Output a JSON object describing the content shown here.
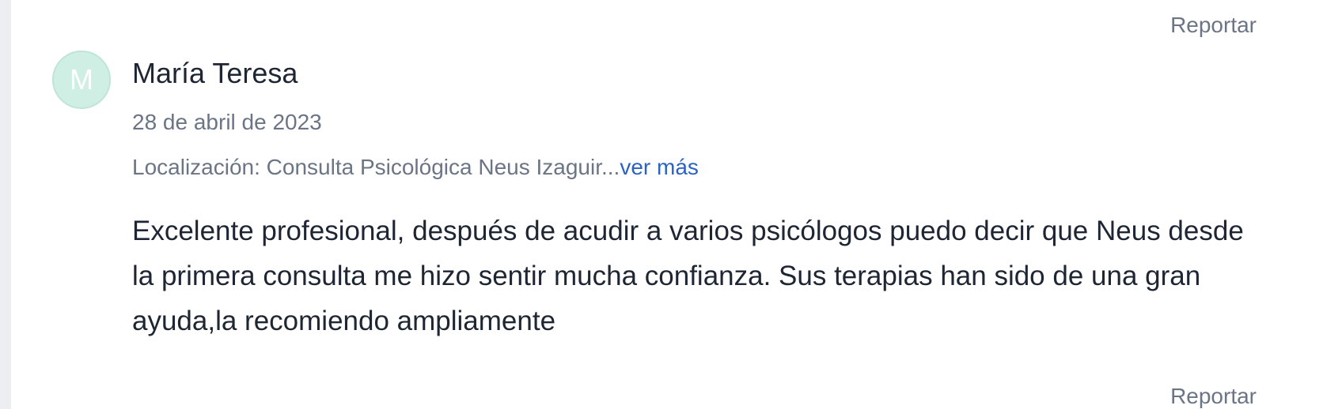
{
  "review": {
    "report_top_label": "Reportar",
    "avatar_initial": "M",
    "author_name": "María Teresa",
    "date": "28 de abril de 2023",
    "location_text": "Localización: Consulta Psicológica Neus Izaguir...",
    "see_more_label": "ver más",
    "text": "Excelente profesional, después de acudir a varios psicólogos puedo decir que Neus desde la primera consulta me hizo sentir mucha confianza. Sus terapias han sido de una gran ayuda,la recomiendo ampliamente",
    "report_bottom_label": "Reportar"
  },
  "colors": {
    "avatar_bg": "#cfeee4",
    "link_blue": "#2b63c4",
    "muted_text": "#6b7585",
    "body_text": "#1f2633"
  }
}
